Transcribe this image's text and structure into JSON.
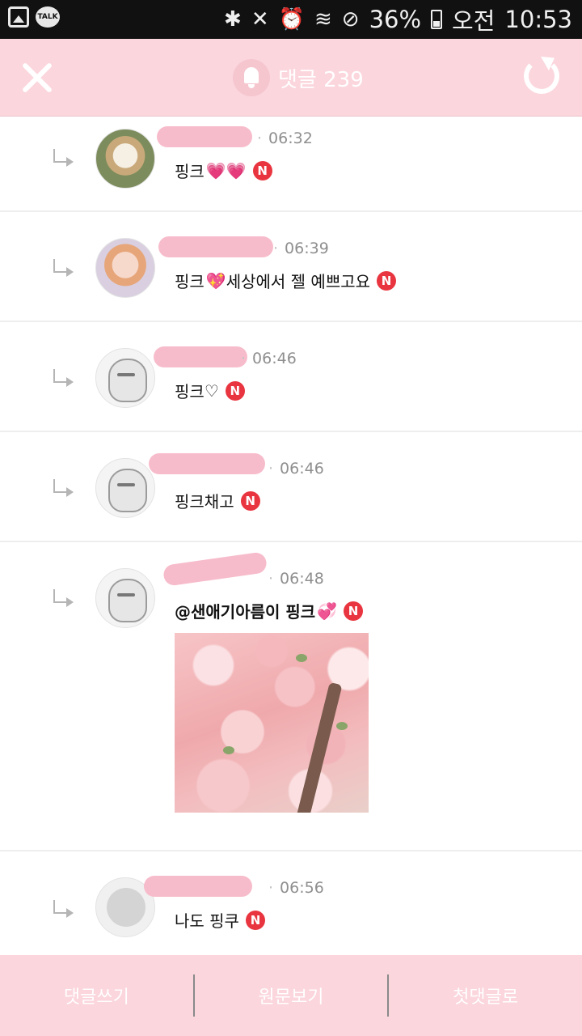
{
  "status_bar": {
    "talk_label": "TALK",
    "battery": "36%",
    "ampm": "오전",
    "time": "10:53",
    "battery_level": 0.36
  },
  "header": {
    "title": "댓글 239"
  },
  "comments": [
    {
      "time": "06:32",
      "text": "핑크",
      "hearts": "💗💗",
      "badge": "N"
    },
    {
      "time": "06:39",
      "text_before": "핑크",
      "heart": "💖",
      "text_after": "세상에서 젤 예쁘고요",
      "badge": "N"
    },
    {
      "time": "06:46",
      "text": "핑크",
      "heart": "♡",
      "badge": "N"
    },
    {
      "time": "06:46",
      "text": "핑크채고",
      "badge": "N"
    },
    {
      "time": "06:48",
      "text": "@샌애기아름이  핑크",
      "heart": "💞",
      "badge": "N"
    },
    {
      "time": "06:56",
      "text": "나도 핑쿠",
      "badge": "N"
    }
  ],
  "bottom_bar": {
    "write_label": "댓글쓰기",
    "original_label": "원문보기",
    "first_label": "첫댓글로"
  },
  "colors": {
    "header_bg": "#fbd6dd",
    "badge": "#e9353f",
    "heart": "#ec2d8a"
  }
}
